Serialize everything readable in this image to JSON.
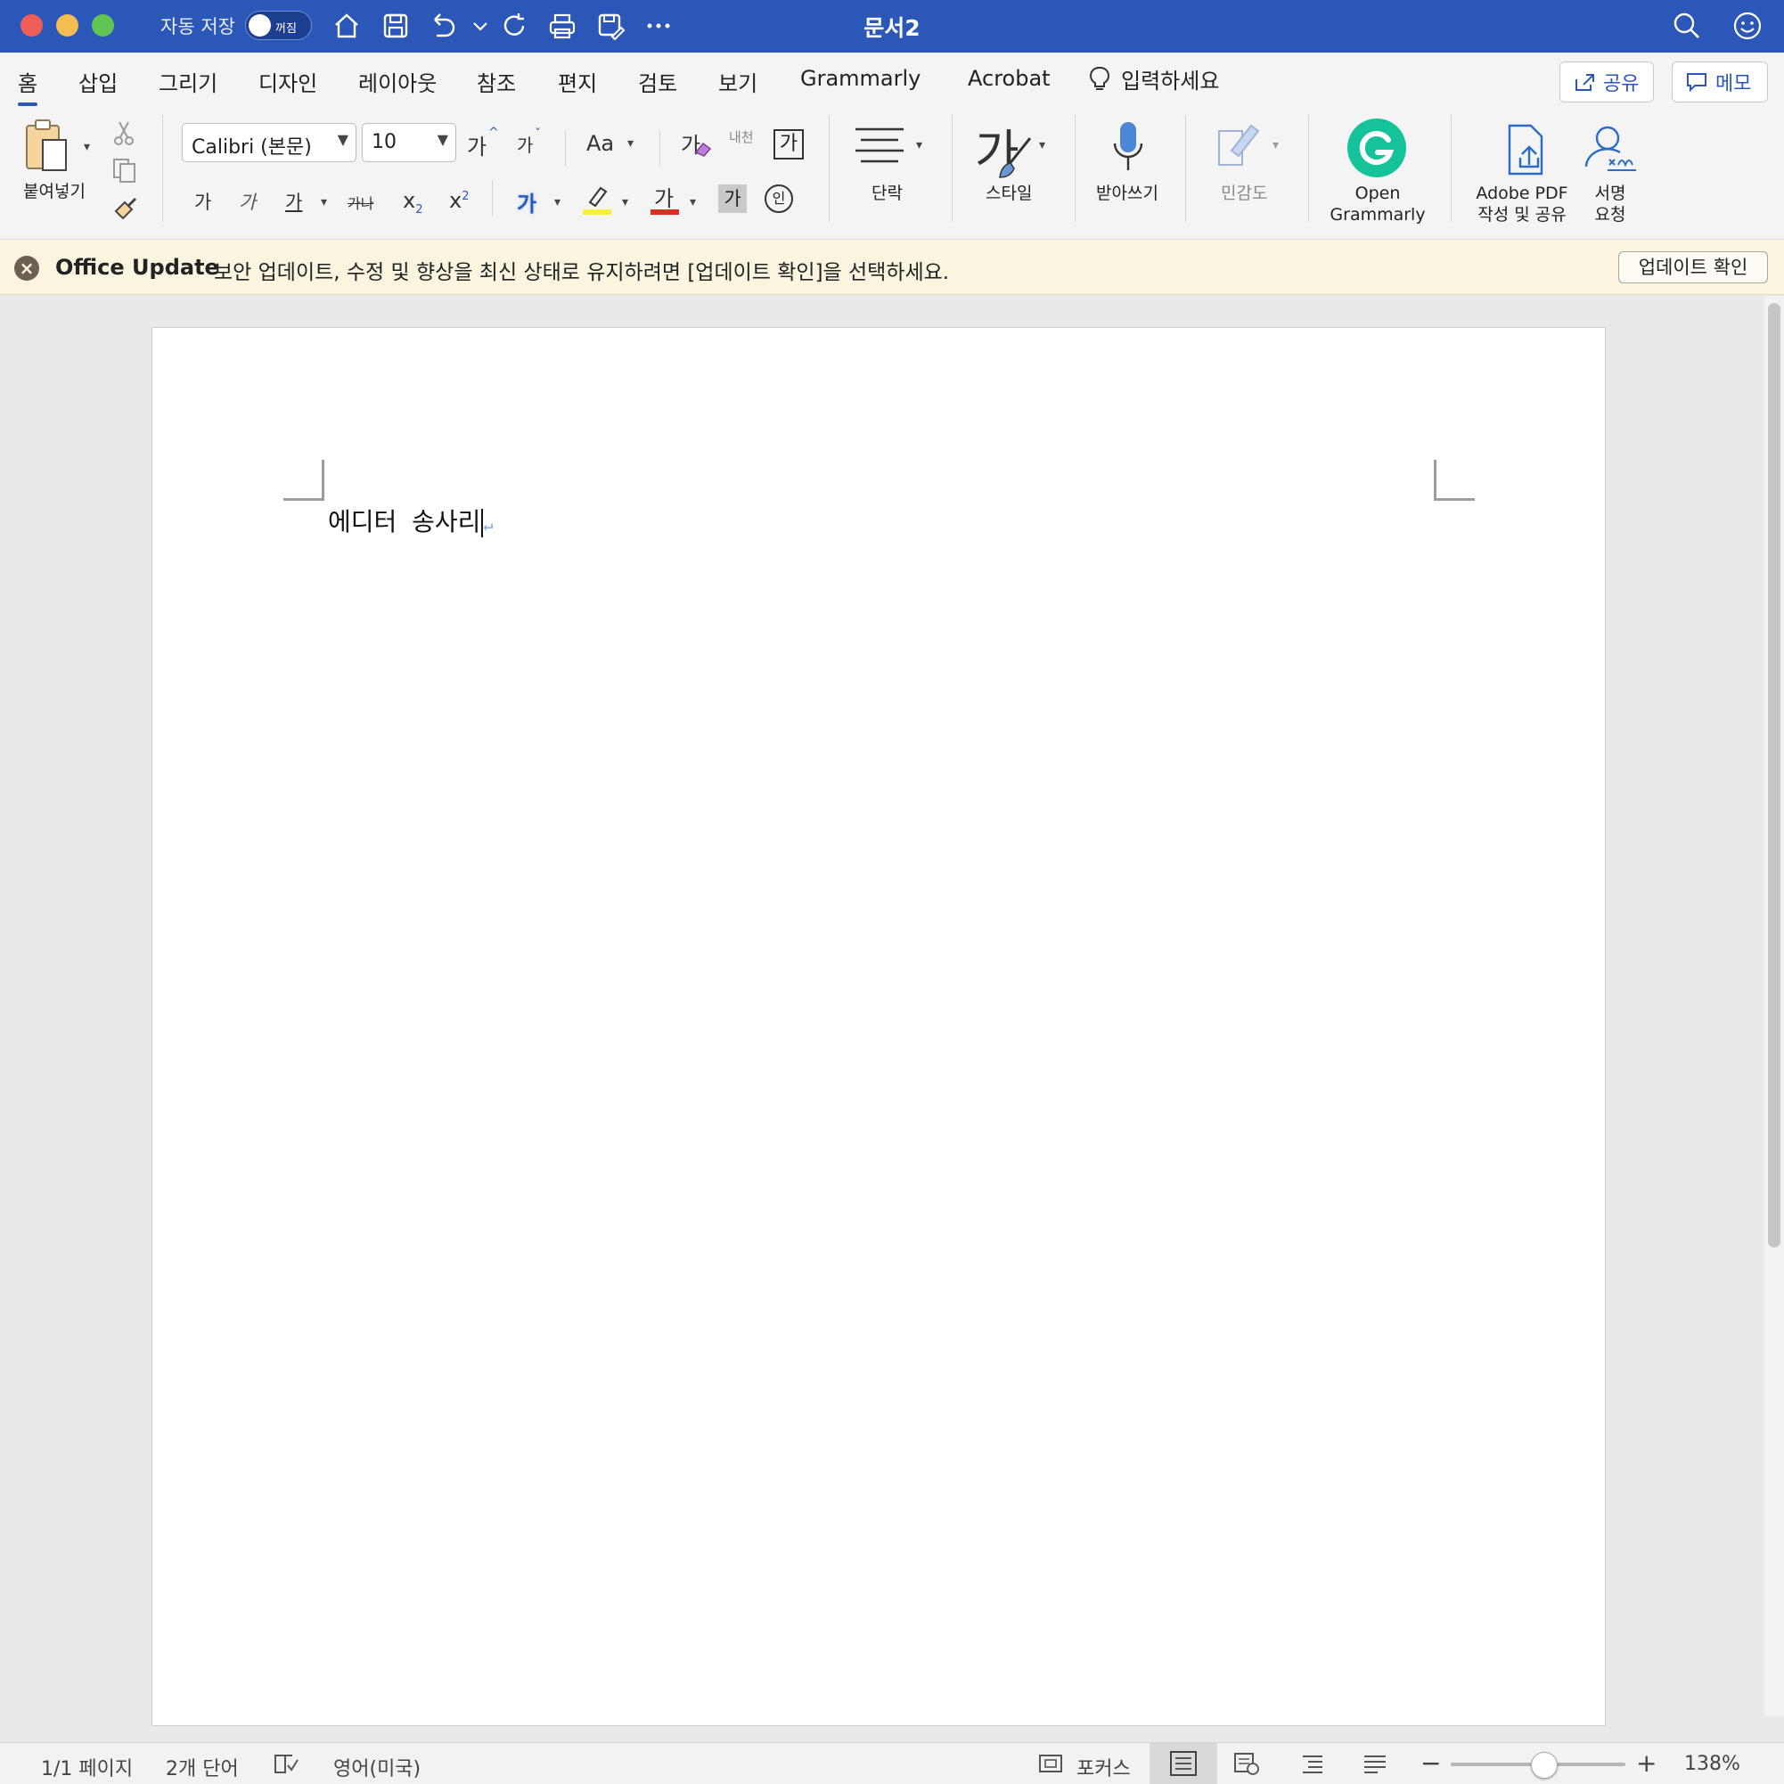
{
  "window": {
    "title": "문서2",
    "autosave_label": "자동 저장",
    "autosave_state": "꺼짐"
  },
  "tabs": [
    "홈",
    "삽입",
    "그리기",
    "디자인",
    "레이아웃",
    "참조",
    "편지",
    "검토",
    "보기",
    "Grammarly",
    "Acrobat"
  ],
  "tell_me": "입력하세요",
  "share_label": "공유",
  "comments_label": "메모",
  "ribbon": {
    "paste_label": "붙여넣기",
    "font_name": "Calibri (본문)",
    "font_size": "10",
    "grow_font": "가",
    "shrink_font": "가",
    "change_case": "Aa",
    "clear_format": "가",
    "phonetic": "내천",
    "enclose": "가",
    "bold": "가",
    "italic": "가",
    "underline": "가",
    "strike": "가나",
    "subscript": "x",
    "superscript": "x",
    "text_effects": "가",
    "font_color": "가",
    "shading": "가",
    "enclosed_char": "인",
    "paragraph_label": "단락",
    "styles_label": "스타일",
    "styles_glyph": "가",
    "dictate_label": "받아쓰기",
    "sensitivity_label": "민감도",
    "grammarly_label_1": "Open",
    "grammarly_label_2": "Grammarly",
    "adobe_label_1": "Adobe PDF",
    "adobe_label_2": "작성 및 공유",
    "sign_label_1": "서명",
    "sign_label_2": "요청"
  },
  "notice": {
    "title": "Office Update",
    "message": "보안 업데이트, 수정 및 향상을 최신 상태로 유지하려면 [업데이트 확인]을 선택하세요.",
    "button": "업데이트 확인"
  },
  "document": {
    "text": "에디터 송사리",
    "pilcrow": "↵"
  },
  "status": {
    "page": "1/1 페이지",
    "words": "2개 단어",
    "language": "영어(미국)",
    "focus": "포커스",
    "zoom": "138%",
    "zoom_minus": "−",
    "zoom_plus": "+"
  },
  "colors": {
    "titlebar": "#2b57b8",
    "accent": "#2b57b8",
    "grammarly": "#15c39a",
    "highlight": "#f7ef3a",
    "font_color": "#e02b20"
  }
}
